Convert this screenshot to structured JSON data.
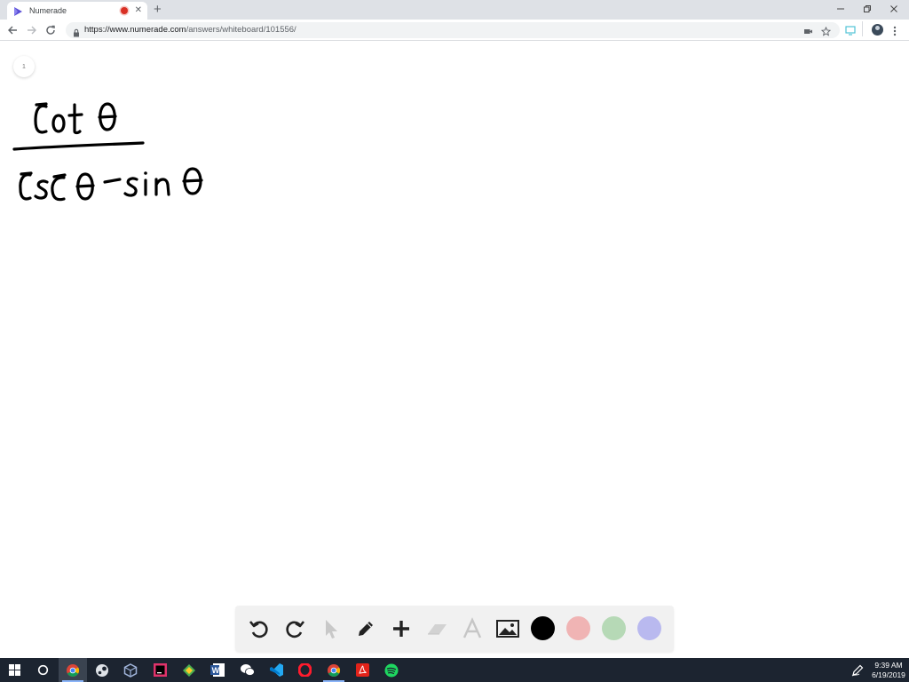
{
  "browser": {
    "tab": {
      "title": "Numerade"
    },
    "omnibox": {
      "host": "https://www.numerade.com",
      "path": "/answers/whiteboard/101556/"
    }
  },
  "whiteboard": {
    "page_number": "1",
    "ink_colors": {
      "ink": "#000000"
    }
  },
  "drawing_tools": {
    "items": [
      "undo-icon",
      "redo-icon",
      "cursor-icon",
      "pen-icon",
      "plus-icon",
      "eraser-icon",
      "text-icon",
      "image-icon"
    ],
    "colors": [
      "#000000",
      "#f0b4b4",
      "#b6d9b6",
      "#b9b9ef"
    ]
  },
  "taskbar": {
    "apps": [
      "chrome",
      "steam",
      "virtualbox",
      "intellij",
      "app-kaleido",
      "word",
      "wechat",
      "vscode",
      "opera",
      "chrome-alt",
      "acrobat",
      "spotify"
    ],
    "time": "9:39 AM",
    "date": "6/19/2019"
  }
}
